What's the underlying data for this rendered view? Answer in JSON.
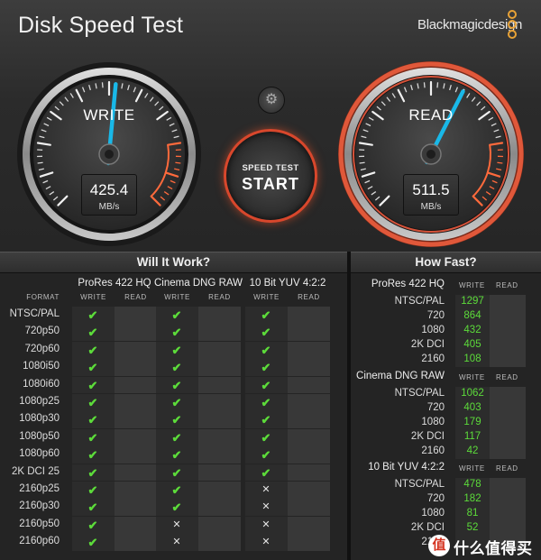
{
  "app": {
    "title": "Disk Speed Test",
    "brand": "Blackmagicdesign",
    "accent_orange": "#e8a236",
    "ok_green": "#5cdb3a",
    "needle_cyan": "#19b8e8"
  },
  "gauges": {
    "write": {
      "label": "WRITE",
      "value": "425.4",
      "unit": "MB/s",
      "needle_fraction": 0.52
    },
    "read": {
      "label": "READ",
      "value": "511.5",
      "unit": "MB/s",
      "needle_fraction": 0.6
    }
  },
  "controls": {
    "settings_icon": "gear-icon",
    "start_small": "SPEED TEST",
    "start_big": "START"
  },
  "will_it_work": {
    "title": "Will It Work?",
    "format_header": "FORMAT",
    "write_header": "WRITE",
    "read_header": "READ",
    "codecs": [
      "ProRes 422 HQ",
      "Cinema DNG RAW",
      "10 Bit YUV 4:2:2"
    ],
    "formats": [
      "NTSC/PAL",
      "720p50",
      "720p60",
      "1080i50",
      "1080i60",
      "1080p25",
      "1080p30",
      "1080p50",
      "1080p60",
      "2K DCI 25",
      "2160p25",
      "2160p30",
      "2160p50",
      "2160p60"
    ],
    "write_ok": [
      [
        true,
        true,
        true
      ],
      [
        true,
        true,
        true
      ],
      [
        true,
        true,
        true
      ],
      [
        true,
        true,
        true
      ],
      [
        true,
        true,
        true
      ],
      [
        true,
        true,
        true
      ],
      [
        true,
        true,
        true
      ],
      [
        true,
        true,
        true
      ],
      [
        true,
        true,
        true
      ],
      [
        true,
        true,
        true
      ],
      [
        true,
        true,
        false
      ],
      [
        true,
        true,
        false
      ],
      [
        true,
        false,
        false
      ],
      [
        true,
        false,
        false
      ]
    ],
    "ok_glyph": "✔",
    "no_glyph": "✕"
  },
  "how_fast": {
    "title": "How Fast?",
    "write_header": "WRITE",
    "read_header": "READ",
    "groups": [
      {
        "name": "ProRes 422 HQ",
        "rows": [
          {
            "label": "NTSC/PAL",
            "write": "1297"
          },
          {
            "label": "720",
            "write": "864"
          },
          {
            "label": "1080",
            "write": "432"
          },
          {
            "label": "2K DCI",
            "write": "405"
          },
          {
            "label": "2160",
            "write": "108"
          }
        ]
      },
      {
        "name": "Cinema DNG RAW",
        "rows": [
          {
            "label": "NTSC/PAL",
            "write": "1062"
          },
          {
            "label": "720",
            "write": "403"
          },
          {
            "label": "1080",
            "write": "179"
          },
          {
            "label": "2K DCI",
            "write": "117"
          },
          {
            "label": "2160",
            "write": "42"
          }
        ]
      },
      {
        "name": "10 Bit YUV 4:2:2",
        "rows": [
          {
            "label": "NTSC/PAL",
            "write": "478"
          },
          {
            "label": "720",
            "write": "182"
          },
          {
            "label": "1080",
            "write": "81"
          },
          {
            "label": "2K DCI",
            "write": "52"
          },
          {
            "label": "2160",
            "write": ""
          }
        ]
      }
    ]
  },
  "watermark": {
    "icon_text": "值",
    "text": "什么值得买"
  }
}
